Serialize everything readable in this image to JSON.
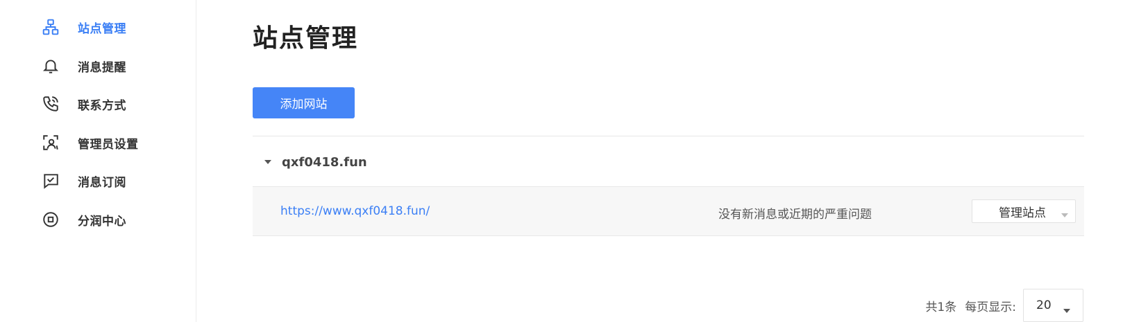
{
  "sidebar": {
    "items": [
      {
        "label": "站点管理",
        "icon": "sitemap-icon",
        "active": true
      },
      {
        "label": "消息提醒",
        "icon": "bell-icon",
        "active": false
      },
      {
        "label": "联系方式",
        "icon": "phone-icon",
        "active": false
      },
      {
        "label": "管理员设置",
        "icon": "admin-user-icon",
        "active": false
      },
      {
        "label": "消息订阅",
        "icon": "message-check-icon",
        "active": false
      },
      {
        "label": "分润中心",
        "icon": "profit-center-icon",
        "active": false
      }
    ]
  },
  "main": {
    "title": "站点管理",
    "add_button_label": "添加网站",
    "site_group": {
      "name": "qxf0418.fun",
      "sites": [
        {
          "url": "https://www.qxf0418.fun/",
          "status": "没有新消息或近期的严重问题",
          "action_label": "管理站点"
        }
      ]
    }
  },
  "pagination": {
    "total_label": "共1条",
    "per_page_label": "每页显示:",
    "page_size": "20"
  },
  "colors": {
    "accent": "#3b7ff5",
    "button_bg": "#4585f7",
    "row_bg": "#f7f7f7"
  }
}
